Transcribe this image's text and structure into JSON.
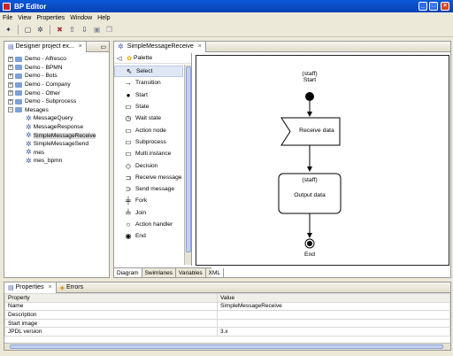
{
  "window": {
    "title": "BP Editor",
    "minimize": "_",
    "maximize": "□",
    "close": "×"
  },
  "menu": [
    "File",
    "View",
    "Properties",
    "Window",
    "Help"
  ],
  "project_panel": {
    "tab_label": "Designer project ex...",
    "tree": [
      {
        "label": "Demo - Alfresco",
        "type": "folder",
        "expander": "+"
      },
      {
        "label": "Demo - BPMN",
        "type": "folder",
        "expander": "+"
      },
      {
        "label": "Demo - Bots",
        "type": "folder",
        "expander": "+"
      },
      {
        "label": "Demo - Company",
        "type": "folder",
        "expander": "+"
      },
      {
        "label": "Demo - Other",
        "type": "folder",
        "expander": "+"
      },
      {
        "label": "Demo - Subprocess",
        "type": "folder",
        "expander": "+"
      },
      {
        "label": "Mesages",
        "type": "folder",
        "expander": "−"
      },
      {
        "label": "MessageQuery",
        "type": "process"
      },
      {
        "label": "MessageResponse",
        "type": "process"
      },
      {
        "label": "SimpleMessageReceive",
        "type": "process",
        "selected": true
      },
      {
        "label": "SimpleMessageSend",
        "type": "process"
      },
      {
        "label": "mes",
        "type": "process"
      },
      {
        "label": "mes_bpmn",
        "type": "process"
      }
    ]
  },
  "editor": {
    "tab_label": "SimpleMessageReceive",
    "palette_title": "Palette",
    "palette_items": [
      {
        "label": "Select",
        "icon": "pointer-icon",
        "selected": true
      },
      {
        "label": "Transition",
        "icon": "arrow-icon"
      },
      {
        "label": "Start",
        "icon": "start-dot-icon"
      },
      {
        "label": "State",
        "icon": "state-box-icon"
      },
      {
        "label": "Wait state",
        "icon": "clock-icon"
      },
      {
        "label": "Action node",
        "icon": "action-node-icon"
      },
      {
        "label": "Subprocess",
        "icon": "subprocess-icon"
      },
      {
        "label": "Multi instance",
        "icon": "multi-instance-icon"
      },
      {
        "label": "Decision",
        "icon": "diamond-icon"
      },
      {
        "label": "Receive message",
        "icon": "receive-message-icon"
      },
      {
        "label": "Send message",
        "icon": "send-message-icon"
      },
      {
        "label": "Fork",
        "icon": "fork-icon"
      },
      {
        "label": "Join",
        "icon": "join-icon"
      },
      {
        "label": "Action handler",
        "icon": "action-handler-icon"
      },
      {
        "label": "End",
        "icon": "end-icon"
      }
    ],
    "bottom_tabs": [
      "Diagram",
      "Swimlanes",
      "Variables",
      "XML"
    ],
    "diagram": {
      "start_role": "(staff)",
      "start_label": "Start",
      "receive_label": "Receive data",
      "output_role": "(staff)",
      "output_label": "Output data",
      "end_label": "End"
    }
  },
  "bottom_panel": {
    "tabs": [
      "Properties",
      "Errors"
    ],
    "headers": [
      "Property",
      "Value"
    ],
    "rows": [
      {
        "property": "Name",
        "value": "SimpleMessageReceive"
      },
      {
        "property": "Description",
        "value": ""
      },
      {
        "property": "Start image",
        "value": ""
      },
      {
        "property": "JPDL version",
        "value": "3.x"
      }
    ]
  }
}
